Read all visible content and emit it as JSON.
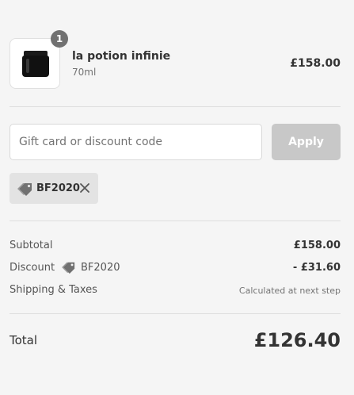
{
  "product": {
    "quantity": "1",
    "name": "la potion infinie",
    "variant": "70ml",
    "price": "£158.00"
  },
  "discount": {
    "placeholder": "Gift card or discount code",
    "apply_label": "Apply",
    "applied_code": "BF2020"
  },
  "summary": {
    "subtotal_label": "Subtotal",
    "subtotal_value": "£158.00",
    "discount_label": "Discount",
    "discount_code": "BF2020",
    "discount_value": "- £31.60",
    "shipping_label": "Shipping & Taxes",
    "shipping_value": "Calculated at next step",
    "total_label": "Total",
    "total_value": "£126.40"
  },
  "colors": {
    "background": "#f5f5f5",
    "apply_disabled": "#c8c8c8",
    "badge": "#717171",
    "chip": "#e3e3e3"
  }
}
